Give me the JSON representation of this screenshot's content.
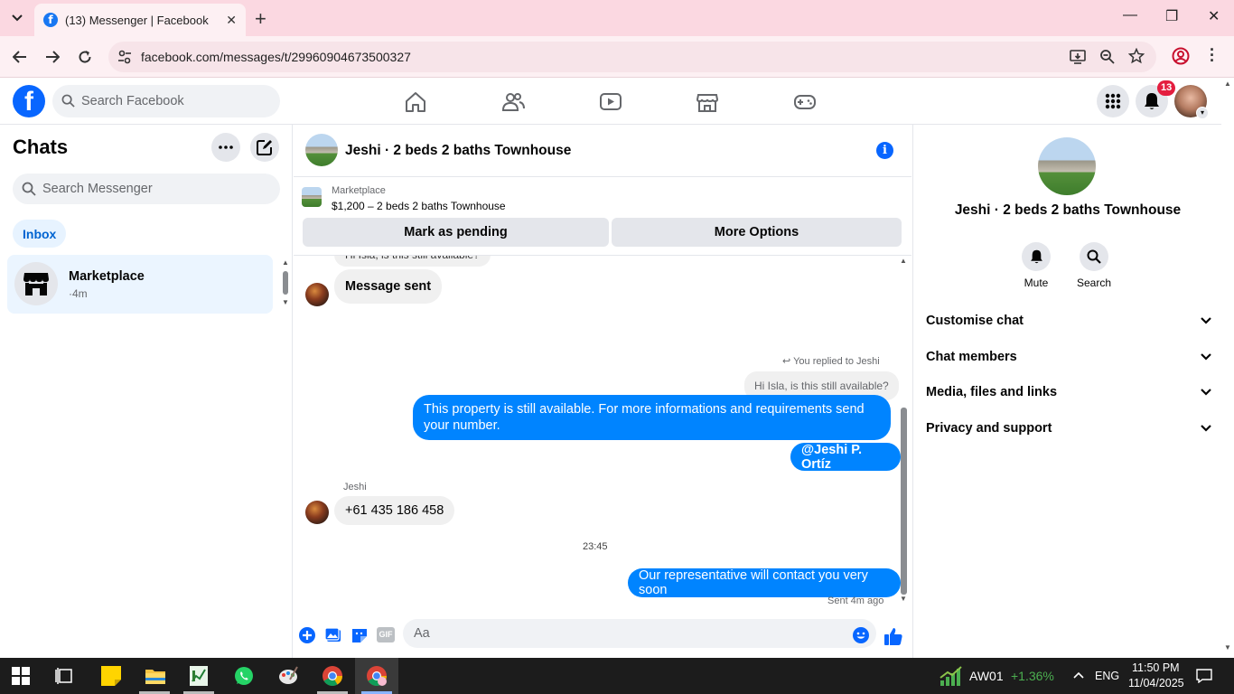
{
  "browser": {
    "tab_title": "(13) Messenger | Facebook",
    "url": "facebook.com/messages/t/29960904673500327"
  },
  "header": {
    "search_placeholder": "Search Facebook",
    "notification_count": "13",
    "brand_color": "#0866ff"
  },
  "sidebar": {
    "title": "Chats",
    "search_placeholder": "Search Messenger",
    "filter": "Inbox",
    "conversations": [
      {
        "name": "Marketplace",
        "time": "·4m"
      }
    ]
  },
  "conversation": {
    "title": "Jeshi · 2 beds 2 baths Townhouse",
    "marketplace_label": "Marketplace",
    "listing": "$1,200 – 2 beds 2 baths Townhouse",
    "mark_pending": "Mark as pending",
    "more_options": "More Options",
    "messages": {
      "cut_top": "Hi Isla, is this still available?",
      "sent_notice": "Message sent",
      "reply_label": "You replied to Jeshi",
      "reply_quote": "Hi Isla, is this still available?",
      "out_1": "This property is still available. For more informations and requirements send your number.",
      "out_2": "@Jeshi P. Ortíz",
      "sender_name": "Jeshi",
      "in_1": "+61 435 186 458",
      "timestamp": "23:45",
      "out_3": "Our representative will contact you very soon",
      "status": "Sent 4m ago"
    },
    "composer_placeholder": "Aa",
    "composer_gif": "GIF",
    "outgoing_color": "#0084ff"
  },
  "info_panel": {
    "title": "Jeshi · 2 beds 2 baths Townhouse",
    "actions": [
      "Mute",
      "Search"
    ],
    "sections": [
      "Customise chat",
      "Chat members",
      "Media, files and links",
      "Privacy and support"
    ]
  },
  "taskbar": {
    "ticker_symbol": "AW01",
    "ticker_change": "+1.36%",
    "language": "ENG",
    "time": "11:50 PM",
    "date": "11/04/2025"
  }
}
